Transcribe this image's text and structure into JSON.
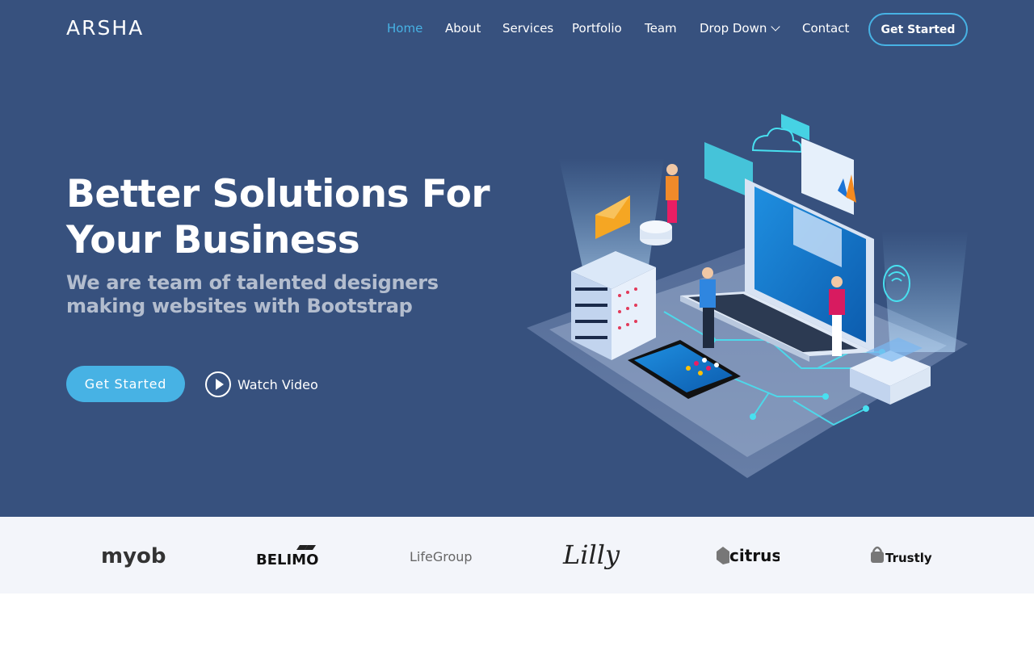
{
  "brand": {
    "logo_text": "ARSHA"
  },
  "nav": {
    "items": [
      {
        "label": "Home",
        "active": true
      },
      {
        "label": "About"
      },
      {
        "label": "Services"
      },
      {
        "label": "Portfolio"
      },
      {
        "label": "Team"
      },
      {
        "label": "Drop Down",
        "has_dropdown": true
      },
      {
        "label": "Contact"
      }
    ],
    "cta_label": "Get Started"
  },
  "hero": {
    "title_line1": "Better Solutions For",
    "title_line2": "Your Business",
    "subtitle": "We are team of talented designers making websites with Bootstrap",
    "primary_button": "Get Started",
    "video_link": "Watch Video",
    "illustration": "isometric-laptop-servers-illustration"
  },
  "clients": {
    "logos": [
      {
        "name": "myob"
      },
      {
        "name": "BELIMO"
      },
      {
        "name": "LifeGroups"
      },
      {
        "name": "Lilly"
      },
      {
        "name": "citrus"
      },
      {
        "name": "Trustly"
      }
    ]
  },
  "colors": {
    "hero_bg": "#37517e",
    "accent": "#47b2e4",
    "clients_bg": "#f3f5fa"
  }
}
